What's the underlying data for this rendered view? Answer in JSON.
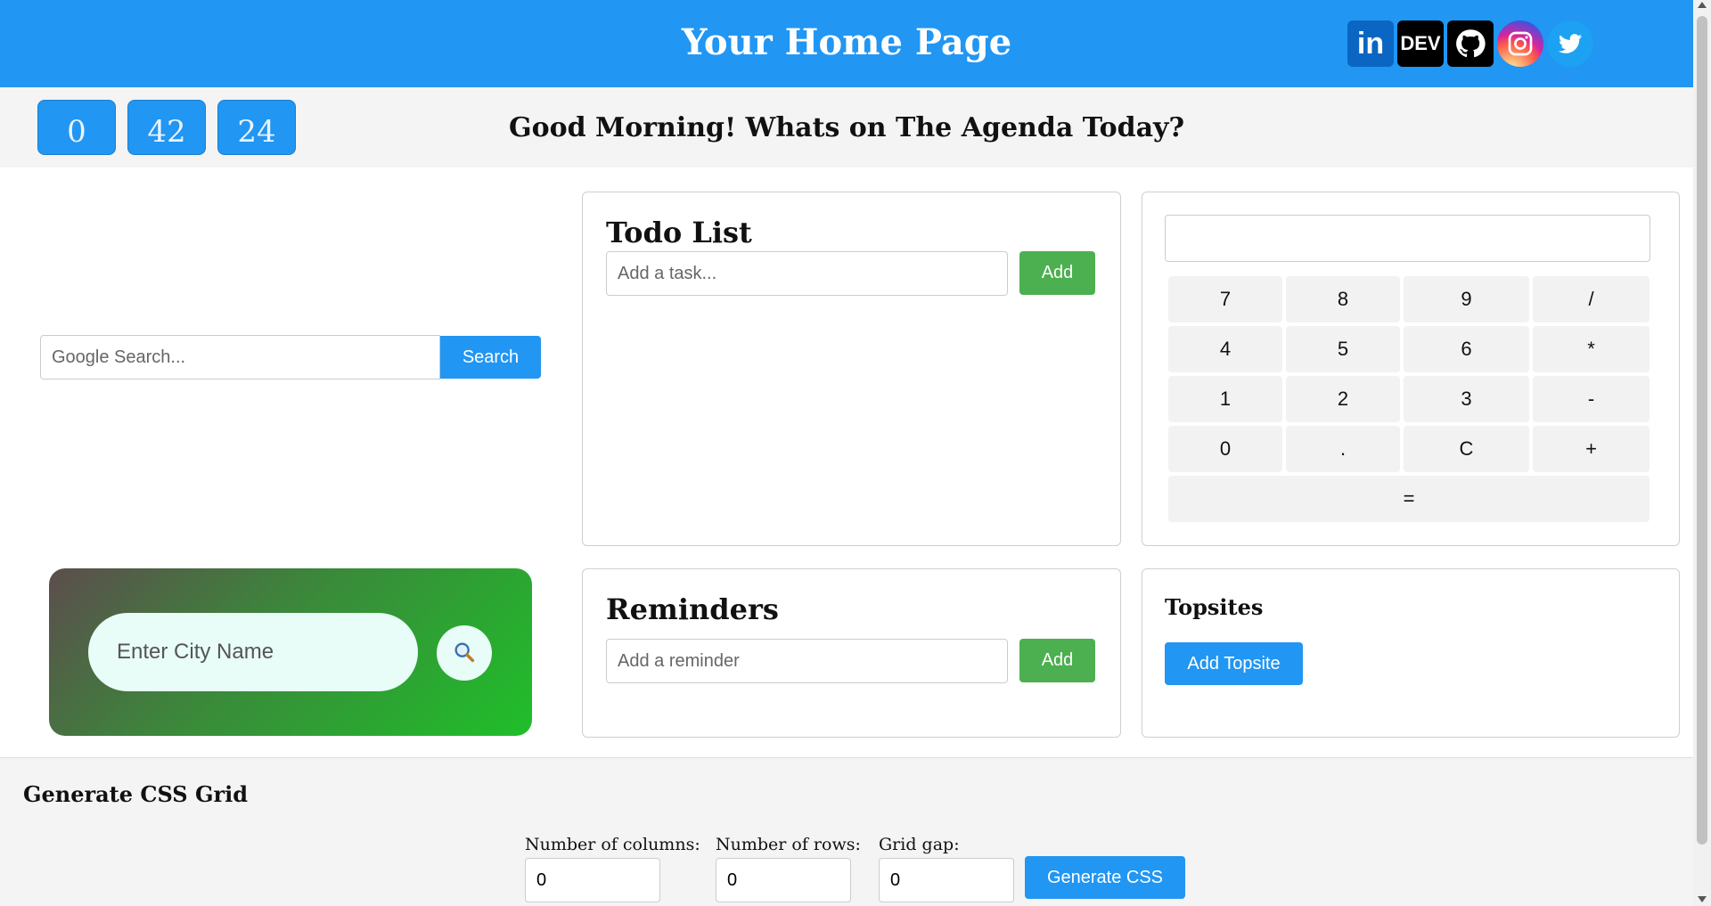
{
  "header": {
    "title": "Your Home Page",
    "socials": [
      {
        "name": "linkedin",
        "text": "in"
      },
      {
        "name": "dev",
        "text": "DEV"
      },
      {
        "name": "github",
        "text": ""
      },
      {
        "name": "instagram",
        "text": ""
      },
      {
        "name": "twitter",
        "text": ""
      }
    ]
  },
  "clock": {
    "hours": "0",
    "minutes": "42",
    "seconds": "24"
  },
  "greeting": "Good Morning! Whats on The Agenda Today?",
  "google_search": {
    "placeholder": "Google Search...",
    "button": "Search"
  },
  "todo": {
    "title": "Todo List",
    "placeholder": "Add a task...",
    "button": "Add"
  },
  "calculator": {
    "display": "",
    "keys": [
      "7",
      "8",
      "9",
      "/",
      "4",
      "5",
      "6",
      "*",
      "1",
      "2",
      "3",
      "-",
      "0",
      ".",
      "C",
      "+"
    ],
    "equals": "="
  },
  "weather": {
    "placeholder": "Enter City Name"
  },
  "reminders": {
    "title": "Reminders",
    "placeholder": "Add a reminder",
    "button": "Add"
  },
  "topsites": {
    "title": "Topsites",
    "button": "Add Topsite"
  },
  "grid_generator": {
    "title": "Generate CSS Grid",
    "columns_label": "Number of columns:",
    "columns_value": "0",
    "rows_label": "Number of rows:",
    "rows_value": "0",
    "gap_label": "Grid gap:",
    "gap_value": "0",
    "button": "Generate CSS"
  },
  "colors": {
    "header": "#2196f3",
    "add_button": "#4caf50"
  }
}
